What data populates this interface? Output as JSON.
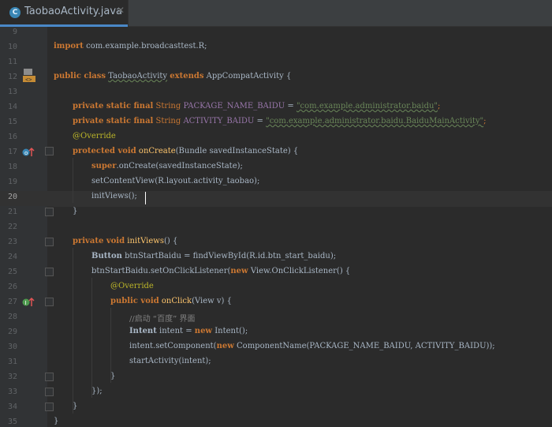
{
  "tab": {
    "title": "TaobaoActivity.java",
    "icon": "C"
  },
  "gutter": {
    "line_numbers": [
      "9",
      "10",
      "11",
      "12",
      "13",
      "14",
      "15",
      "16",
      "17",
      "18",
      "19",
      "20",
      "21",
      "22",
      "23",
      "24",
      "25",
      "26",
      "27",
      "28",
      "29",
      "30",
      "31",
      "32",
      "33",
      "34",
      "35"
    ]
  },
  "code": {
    "l10": {
      "kw": "import",
      "rest": "com.example.broadcasttest.R;"
    },
    "l12": {
      "kw": "public class",
      "name": "TaobaoActivity",
      "kw2": "extends",
      "rest": "AppCompatActivity {"
    },
    "l14": {
      "kw": "private static final",
      "type": "String",
      "name": "PACKAGE_NAME_BAIDU",
      "eq": "=",
      "val": "\"com.example.administrator.baidu\"",
      "end": ";"
    },
    "l15": {
      "kw": "private static final",
      "type": "String",
      "name": "ACTIVITY_BAIDU",
      "eq": "=",
      "val": "\"com.example.administrator.baidu.BaiduMainActivity\"",
      "end": ";"
    },
    "l16": {
      "ann": "@Override"
    },
    "l17": {
      "kw": "protected void",
      "name": "onCreate",
      "rest": "(Bundle savedInstanceState) {"
    },
    "l18": {
      "kw": "super",
      "rest": ".onCreate(savedInstanceState);"
    },
    "l19": {
      "rest": "setContentView(R.layout.activity_taobao);"
    },
    "l20": {
      "rest": "initViews();"
    },
    "l21": {
      "rest": "}"
    },
    "l23": {
      "kw": "private void",
      "name": "initViews",
      "rest": "() {"
    },
    "l24": {
      "type": "Button",
      "rest": "btnStartBaidu = findViewById(R.id.btn_start_baidu);"
    },
    "l25": {
      "rest": "btnStartBaidu.setOnClickListener(",
      "kw": "new",
      "rest2": "View.OnClickListener() {"
    },
    "l26": {
      "ann": "@Override"
    },
    "l27": {
      "kw": "public void",
      "name": "onClick",
      "rest": "(View v) {"
    },
    "l28": {
      "cmt": "//启动 “百度” 界面"
    },
    "l29": {
      "type": "Intent",
      "rest": "intent =",
      "kw": "new",
      "rest2": "Intent();"
    },
    "l30": {
      "rest": "intent.setComponent(",
      "kw": "new",
      "rest2": "ComponentName(PACKAGE_NAME_BAIDU, ACTIVITY_BAIDU));"
    },
    "l31": {
      "rest": "startActivity(intent);"
    },
    "l32": {
      "rest": "}"
    },
    "l33": {
      "rest": "});"
    },
    "l34": {
      "rest": "}"
    },
    "l35": {
      "rest": "}"
    }
  }
}
